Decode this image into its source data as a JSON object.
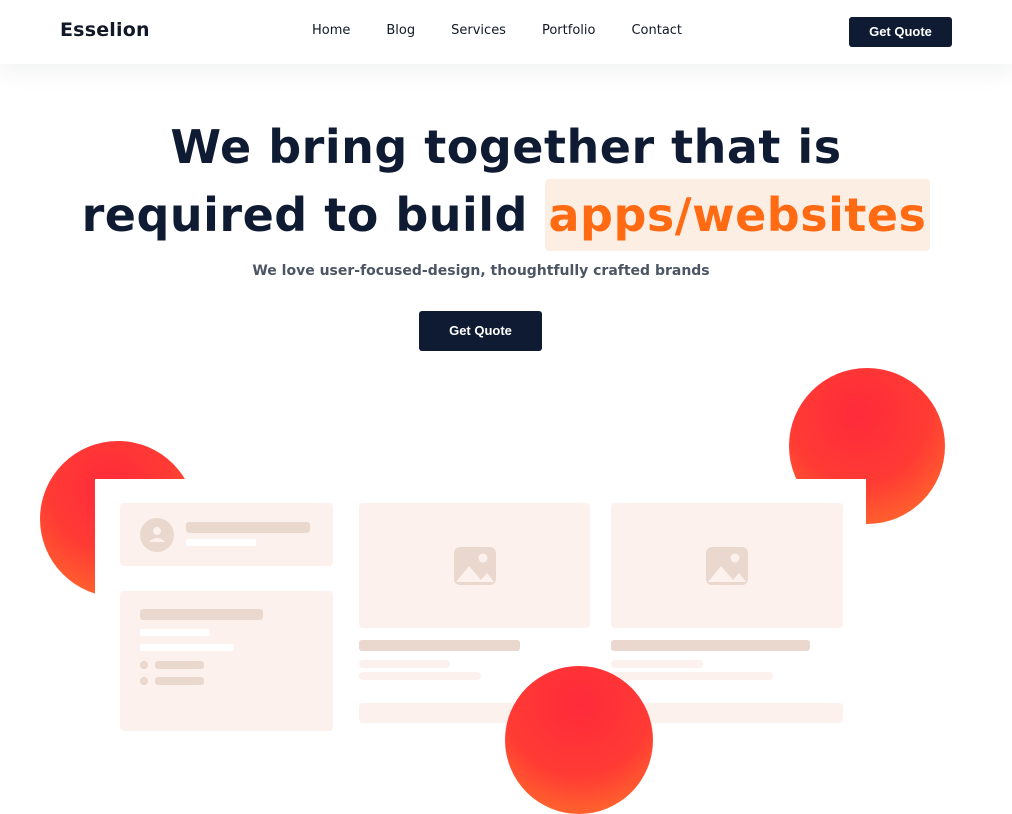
{
  "header": {
    "logo": "Esselion",
    "menu": [
      "Home",
      "Blog",
      "Services",
      "Portfolio",
      "Contact"
    ],
    "cta_label": "Get Quote"
  },
  "hero": {
    "title_line1": "We bring together that is",
    "title_line2_prefix": "required to build",
    "title_highlight": "apps/websites",
    "subtitle": "We love user-focused-design, thoughtfully crafted brands",
    "cta_label": "Get Quote"
  },
  "colors": {
    "navy": "#0f1b33",
    "accent_orange": "#ff6a13",
    "highlight_bg": "#fdeee4",
    "blob_red": "#ff3b34",
    "card_bg": "#fcf1ec",
    "placeholder_bar": "#ead8cf"
  },
  "icons": [
    "user-avatar-icon",
    "image-placeholder-icon"
  ]
}
